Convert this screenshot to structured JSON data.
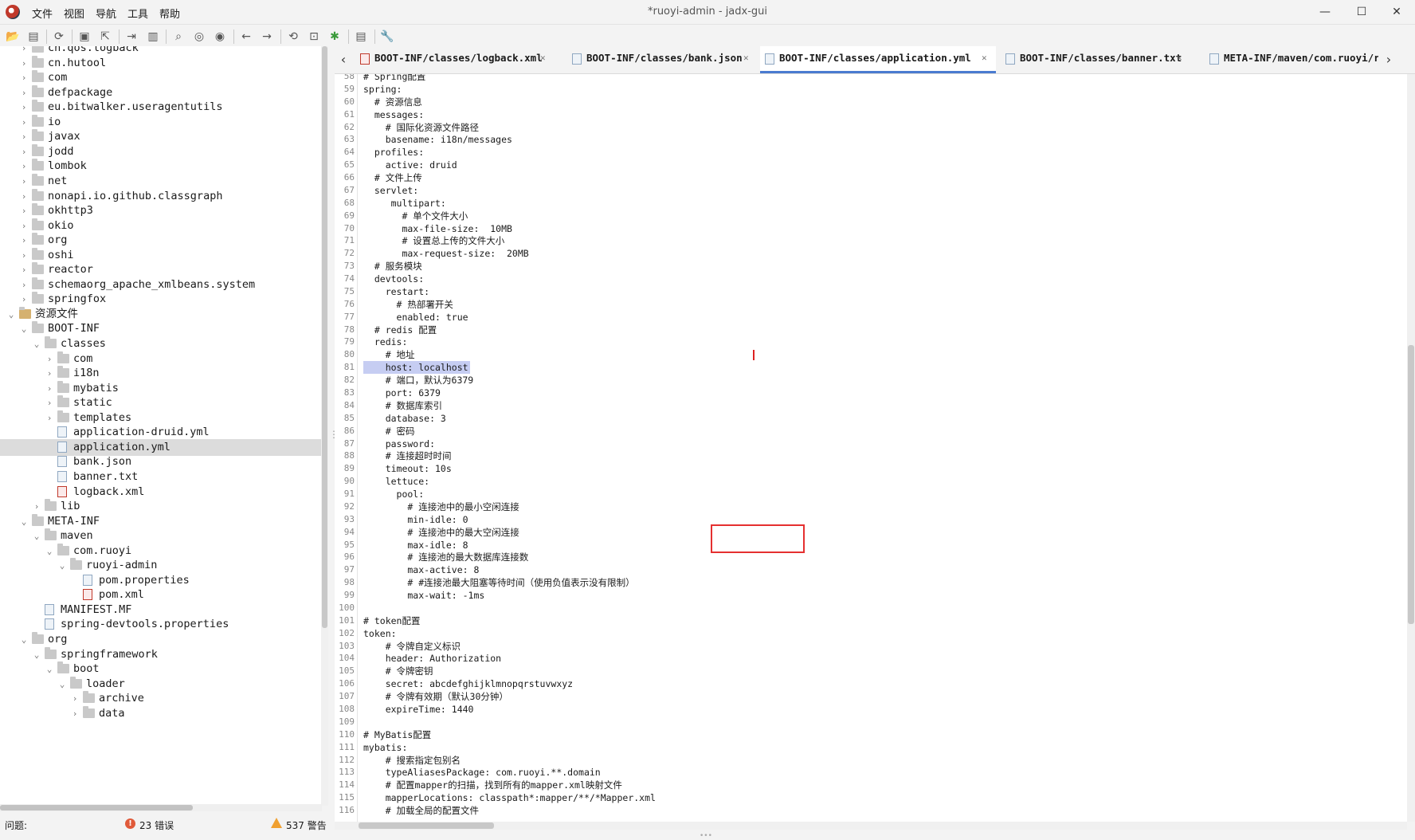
{
  "window": {
    "title": "*ruoyi-admin - jadx-gui",
    "minimize": "—",
    "maximize": "☐",
    "close": "✕"
  },
  "menu": [
    "文件",
    "视图",
    "导航",
    "工具",
    "帮助"
  ],
  "toolbar": {
    "icons": [
      "open-icon",
      "add-files-icon",
      "sync-icon",
      "save-icon",
      "export-icon",
      "flatten-icon",
      "packages-icon",
      "search-icon",
      "find-usage-icon",
      "find-text-icon",
      "back-icon",
      "forward-icon",
      "decompile-all-icon",
      "bookmark-icon",
      "debug-icon",
      "log-icon",
      "settings-icon"
    ]
  },
  "tree": {
    "rows": [
      {
        "label": "ch.qos.logback",
        "icon": "folder",
        "expander": "›"
      },
      {
        "label": "cn.hutool",
        "icon": "folder",
        "expander": "›"
      },
      {
        "label": "com",
        "icon": "folder",
        "expander": "›"
      },
      {
        "label": "defpackage",
        "icon": "folder",
        "expander": "›"
      },
      {
        "label": "eu.bitwalker.useragentutils",
        "icon": "folder",
        "expander": "›"
      },
      {
        "label": "io",
        "icon": "folder",
        "expander": "›"
      },
      {
        "label": "javax",
        "icon": "folder",
        "expander": "›"
      },
      {
        "label": "jodd",
        "icon": "folder",
        "expander": "›"
      },
      {
        "label": "lombok",
        "icon": "folder",
        "expander": "›"
      },
      {
        "label": "net",
        "icon": "folder",
        "expander": "›"
      },
      {
        "label": "nonapi.io.github.classgraph",
        "icon": "folder",
        "expander": "›"
      },
      {
        "label": "okhttp3",
        "icon": "folder",
        "expander": "›"
      },
      {
        "label": "okio",
        "icon": "folder",
        "expander": "›"
      },
      {
        "label": "org",
        "icon": "folder",
        "expander": "›"
      },
      {
        "label": "oshi",
        "icon": "folder",
        "expander": "›"
      },
      {
        "label": "reactor",
        "icon": "folder",
        "expander": "›"
      },
      {
        "label": "schemaorg_apache_xmlbeans.system",
        "icon": "folder",
        "expander": "›"
      },
      {
        "label": "springfox",
        "icon": "folder",
        "expander": "›"
      },
      {
        "label": "资源文件",
        "icon": "resources",
        "expander": "⌄"
      },
      {
        "label": "BOOT-INF",
        "icon": "folder",
        "expander": "⌄"
      },
      {
        "label": "classes",
        "icon": "folder",
        "expander": "⌄"
      },
      {
        "label": "com",
        "icon": "folder",
        "expander": "›"
      },
      {
        "label": "i18n",
        "icon": "folder",
        "expander": "›"
      },
      {
        "label": "mybatis",
        "icon": "folder",
        "expander": "›"
      },
      {
        "label": "static",
        "icon": "folder",
        "expander": "›"
      },
      {
        "label": "templates",
        "icon": "folder",
        "expander": "›"
      },
      {
        "label": "application-druid.yml",
        "icon": "file",
        "expander": ""
      },
      {
        "label": "application.yml",
        "icon": "file",
        "expander": ""
      },
      {
        "label": "bank.json",
        "icon": "file",
        "expander": ""
      },
      {
        "label": "banner.txt",
        "icon": "file",
        "expander": ""
      },
      {
        "label": "logback.xml",
        "icon": "xml",
        "expander": ""
      },
      {
        "label": "lib",
        "icon": "folder",
        "expander": "›"
      },
      {
        "label": "META-INF",
        "icon": "folder",
        "expander": "⌄"
      },
      {
        "label": "maven",
        "icon": "folder",
        "expander": "⌄"
      },
      {
        "label": "com.ruoyi",
        "icon": "folder",
        "expander": "⌄"
      },
      {
        "label": "ruoyi-admin",
        "icon": "folder",
        "expander": "⌄"
      },
      {
        "label": "pom.properties",
        "icon": "file",
        "expander": ""
      },
      {
        "label": "pom.xml",
        "icon": "xml",
        "expander": ""
      },
      {
        "label": "MANIFEST.MF",
        "icon": "file",
        "expander": ""
      },
      {
        "label": "spring-devtools.properties",
        "icon": "file",
        "expander": ""
      },
      {
        "label": "org",
        "icon": "folder",
        "expander": "⌄"
      },
      {
        "label": "springframework",
        "icon": "folder",
        "expander": "⌄"
      },
      {
        "label": "boot",
        "icon": "folder",
        "expander": "⌄"
      },
      {
        "label": "loader",
        "icon": "folder",
        "expander": "⌄"
      },
      {
        "label": "archive",
        "icon": "folder",
        "expander": "›"
      },
      {
        "label": "data",
        "icon": "folder",
        "expander": "›"
      }
    ]
  },
  "tabs": {
    "prev": "‹",
    "next": "›",
    "items": [
      {
        "label": "BOOT-INF/classes/logback.xml",
        "icon": "xml",
        "close": "✕"
      },
      {
        "label": "BOOT-INF/classes/bank.json",
        "icon": "file",
        "close": "✕"
      },
      {
        "label": "BOOT-INF/classes/application.yml",
        "icon": "file",
        "close": "✕"
      },
      {
        "label": "BOOT-INF/classes/banner.txt",
        "icon": "file",
        "close": "✕"
      },
      {
        "label": "META-INF/maven/com.ruoyi/ruo",
        "icon": "file",
        "close": ""
      }
    ]
  },
  "editor": {
    "lines": [
      {
        "n": "58",
        "text": "# Spring配置"
      },
      {
        "n": "59",
        "text": "spring:"
      },
      {
        "n": "60",
        "text": "  # 资源信息"
      },
      {
        "n": "61",
        "text": "  messages:"
      },
      {
        "n": "62",
        "text": "    # 国际化资源文件路径"
      },
      {
        "n": "63",
        "text": "    basename: i18n/messages"
      },
      {
        "n": "64",
        "text": "  profiles:"
      },
      {
        "n": "65",
        "text": "    active: druid"
      },
      {
        "n": "66",
        "text": "  # 文件上传"
      },
      {
        "n": "67",
        "text": "  servlet:"
      },
      {
        "n": "68",
        "text": "     multipart:"
      },
      {
        "n": "69",
        "text": "       # 单个文件大小"
      },
      {
        "n": "70",
        "text": "       max-file-size:  10MB"
      },
      {
        "n": "71",
        "text": "       # 设置总上传的文件大小"
      },
      {
        "n": "72",
        "text": "       max-request-size:  20MB"
      },
      {
        "n": "73",
        "text": "  # 服务模块"
      },
      {
        "n": "74",
        "text": "  devtools:"
      },
      {
        "n": "75",
        "text": "    restart:"
      },
      {
        "n": "76",
        "text": "      # 热部署开关"
      },
      {
        "n": "77",
        "text": "      enabled: true"
      },
      {
        "n": "78",
        "text": "  # redis 配置"
      },
      {
        "n": "79",
        "text": "  redis:"
      },
      {
        "n": "80",
        "text": "    # 地址"
      },
      {
        "n": "81",
        "text": "    host: localhost"
      },
      {
        "n": "82",
        "text": "    # 端口，默认为6379"
      },
      {
        "n": "83",
        "text": "    port: 6379"
      },
      {
        "n": "84",
        "text": "    # 数据库索引"
      },
      {
        "n": "85",
        "text": "    database: 3"
      },
      {
        "n": "86",
        "text": "    # 密码"
      },
      {
        "n": "87",
        "text": "    password:"
      },
      {
        "n": "88",
        "text": "    # 连接超时时间"
      },
      {
        "n": "89",
        "text": "    timeout: 10s"
      },
      {
        "n": "90",
        "text": "    lettuce:"
      },
      {
        "n": "91",
        "text": "      pool:"
      },
      {
        "n": "92",
        "text": "        # 连接池中的最小空闲连接"
      },
      {
        "n": "93",
        "text": "        min-idle: 0"
      },
      {
        "n": "94",
        "text": "        # 连接池中的最大空闲连接"
      },
      {
        "n": "95",
        "text": "        max-idle: 8"
      },
      {
        "n": "96",
        "text": "        # 连接池的最大数据库连接数"
      },
      {
        "n": "97",
        "text": "        max-active: 8"
      },
      {
        "n": "98",
        "text": "        # #连接池最大阻塞等待时间（使用负值表示没有限制）"
      },
      {
        "n": "99",
        "text": "        max-wait: -1ms"
      },
      {
        "n": "100",
        "text": ""
      },
      {
        "n": "101",
        "text": "# token配置"
      },
      {
        "n": "102",
        "text": "token:"
      },
      {
        "n": "103",
        "text": "    # 令牌自定义标识"
      },
      {
        "n": "104",
        "text": "    header: Authorization"
      },
      {
        "n": "105",
        "text": "    # 令牌密钥"
      },
      {
        "n": "106",
        "text": "    secret: abcdefghijklmnopqrstuvwxyz"
      },
      {
        "n": "107",
        "text": "    # 令牌有效期（默认30分钟）"
      },
      {
        "n": "108",
        "text": "    expireTime: 1440"
      },
      {
        "n": "109",
        "text": ""
      },
      {
        "n": "110",
        "text": "# MyBatis配置"
      },
      {
        "n": "111",
        "text": "mybatis:"
      },
      {
        "n": "112",
        "text": "    # 搜索指定包别名"
      },
      {
        "n": "113",
        "text": "    typeAliasesPackage: com.ruoyi.**.domain"
      },
      {
        "n": "114",
        "text": "    # 配置mapper的扫描，找到所有的mapper.xml映射文件"
      },
      {
        "n": "115",
        "text": "    mapperLocations: classpath*:mapper/**/*Mapper.xml"
      },
      {
        "n": "116",
        "text": "    # 加载全局的配置文件"
      }
    ]
  },
  "status": {
    "label": "问题:",
    "errors": "23 错误",
    "warnings": "537 警告"
  }
}
